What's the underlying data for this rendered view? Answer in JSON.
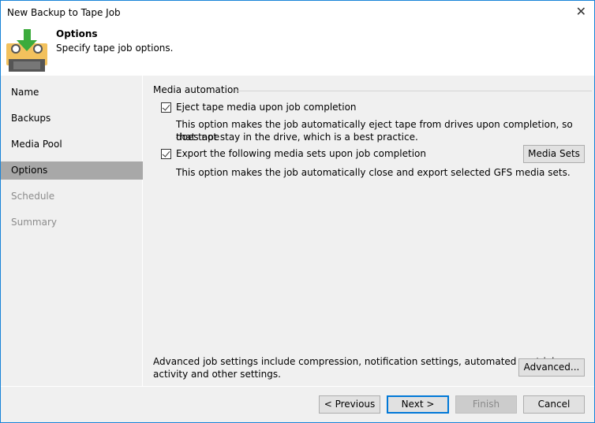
{
  "window": {
    "title": "New Backup to Tape Job"
  },
  "header": {
    "title": "Options",
    "subtitle": "Specify tape job options."
  },
  "sidebar": {
    "items": [
      {
        "label": "Name",
        "state": "normal"
      },
      {
        "label": "Backups",
        "state": "normal"
      },
      {
        "label": "Media Pool",
        "state": "normal"
      },
      {
        "label": "Options",
        "state": "selected"
      },
      {
        "label": "Schedule",
        "state": "disabled"
      },
      {
        "label": "Summary",
        "state": "disabled"
      }
    ]
  },
  "main": {
    "group_label": "Media automation",
    "eject": {
      "label": "Eject tape media upon job completion",
      "checked": true,
      "desc1": "This option makes the job automatically eject tape from drives upon completion, so that tape",
      "desc2": "does not stay in the drive, which is a best practice."
    },
    "export": {
      "label": "Export the following media sets upon job completion",
      "checked": true,
      "desc": "This option makes the job automatically close and export selected GFS media sets.",
      "button": "Media Sets"
    },
    "advanced_text1": "Advanced job settings include compression, notification settings, automated post-job",
    "advanced_text2": "activity and other settings.",
    "advanced_button": "Advanced..."
  },
  "footer": {
    "previous": "< Previous",
    "next": "Next >",
    "finish": "Finish",
    "cancel": "Cancel"
  }
}
